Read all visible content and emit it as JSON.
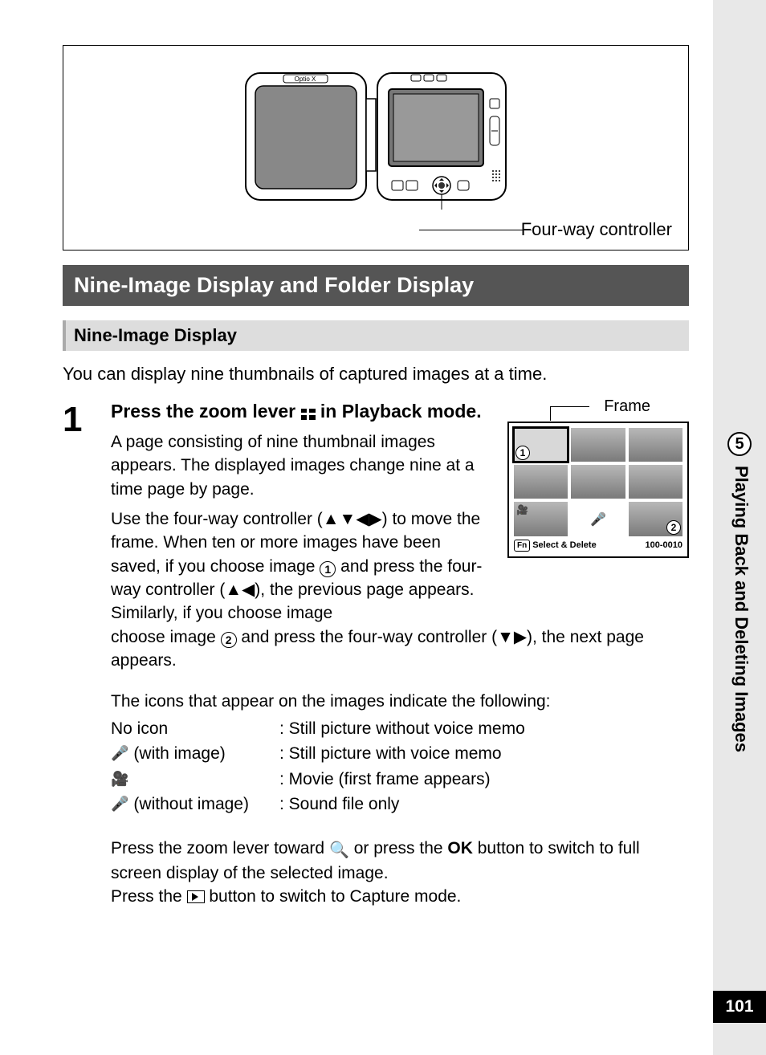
{
  "sidebar": {
    "chapter_number": "5",
    "chapter_title": "Playing Back and Deleting Images",
    "page_number": "101"
  },
  "diagram": {
    "callout": "Four-way controller"
  },
  "section_title": "Nine-Image Display and Folder Display",
  "subsection_title": "Nine-Image Display",
  "intro": "You can display nine thumbnails of captured images at a time.",
  "step": {
    "number": "1",
    "title_a": "Press the zoom lever ",
    "title_b": " in Playback mode.",
    "desc_a": "A page consisting of nine thumbnail images appears. The displayed images change nine at a time page by page.",
    "desc_b": "Use the four-way controller (▲▼◀▶) to move the frame. When ten or more images have been saved, if you choose image ",
    "desc_c": " and press the four-way controller (▲◀), the previous page appears. Similarly, if you choose image ",
    "desc_d": " and press the four-way controller (▼▶), the next page appears.",
    "circled1": "1",
    "circled2": "2"
  },
  "screen": {
    "frame_label": "Frame",
    "fn": "Fn",
    "select_delete": "Select & Delete",
    "folder_num": "100-0010",
    "c1": "1",
    "c2": "2"
  },
  "icons_intro": "The icons that appear on the images indicate the following:",
  "icon_rows": [
    {
      "left": "No icon",
      "right": ": Still picture without voice memo",
      "icon": ""
    },
    {
      "left": "(with image)",
      "right": ": Still picture with voice memo",
      "icon": "mic"
    },
    {
      "left": "",
      "right": ": Movie (first frame appears)",
      "icon": "video"
    },
    {
      "left": "(without image)",
      "right": ": Sound file only",
      "icon": "mic"
    }
  ],
  "final": {
    "a": "Press the zoom lever toward ",
    "b": " or press the ",
    "ok": "OK",
    "c": " button to switch to full screen display of the selected image.",
    "d": "Press the ",
    "e": " button to switch to Capture mode."
  }
}
